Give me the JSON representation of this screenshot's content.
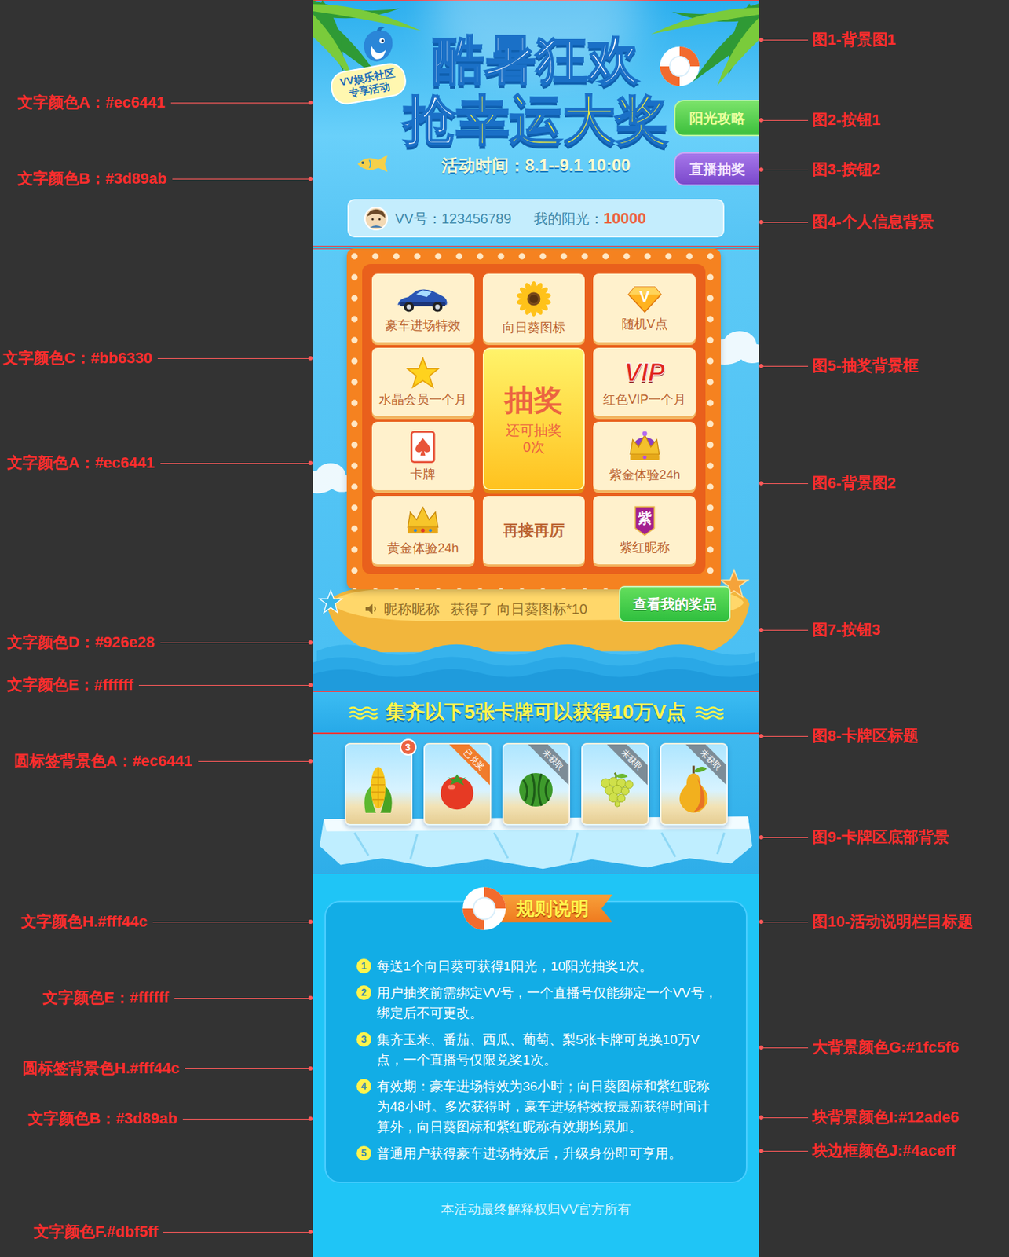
{
  "header": {
    "badge": [
      "VV娱乐社区",
      "专享活动"
    ],
    "title_line1": "酷暑狂欢",
    "title_line2": [
      "抢",
      "幸运大奖"
    ],
    "time": "活动时间：8.1--9.1 10:00",
    "buttons": [
      {
        "label": "阳光攻略",
        "kind": "guide"
      },
      {
        "label": "直播抽奖",
        "kind": "live"
      }
    ]
  },
  "user": {
    "vv_label": "VV号：",
    "vv_number": "123456789",
    "sun_label": "我的阳光：",
    "sun_value": "10000"
  },
  "lottery": {
    "tiles": [
      {
        "kind": "prize",
        "name": "豪车进场特效"
      },
      {
        "kind": "prize",
        "name": "向日葵图标"
      },
      {
        "kind": "prize",
        "name": "随机V点",
        "icon_text": "V"
      },
      {
        "kind": "prize",
        "name": "水晶会员一个月"
      },
      {
        "kind": "prize",
        "name": "红色VIP一个月",
        "icon_text": "VIP"
      },
      {
        "kind": "prize",
        "name": "卡牌"
      },
      {
        "kind": "prize",
        "name": "紫金体验24h"
      },
      {
        "kind": "prize",
        "name": "黄金体验24h"
      },
      {
        "kind": "text",
        "name": "再接再厉"
      },
      {
        "kind": "prize",
        "name": "紫红昵称",
        "icon_text": "紫"
      }
    ],
    "draw": {
      "title": "抽奖",
      "label": "还可抽奖",
      "count": "0次"
    },
    "broadcast": {
      "user": "昵称昵称",
      "message": "获得了 向日葵图标*10"
    },
    "my_prizes_button": "查看我的奖品"
  },
  "cards": {
    "title": "集齐以下5张卡牌可以获得10万V点",
    "items": [
      {
        "status": "count",
        "badge": "3"
      },
      {
        "status": "redeemed",
        "badge": "已兑奖"
      },
      {
        "status": "locked",
        "badge": "未获取"
      },
      {
        "status": "locked",
        "badge": "未获取"
      },
      {
        "status": "locked",
        "badge": "未获取"
      }
    ]
  },
  "rules": {
    "title": "规则说明",
    "items": [
      {
        "num": "1",
        "text": "每送1个向日葵可获得1阳光，10阳光抽奖1次。"
      },
      {
        "num": "2",
        "text": "用户抽奖前需绑定VV号，一个直播号仅能绑定一个VV号，绑定后不可更改。"
      },
      {
        "num": "3",
        "text": "集齐玉米、番茄、西瓜、葡萄、梨5张卡牌可兑换10万V点，一个直播号仅限兑奖1次。"
      },
      {
        "num": "4",
        "text": "有效期：豪车进场特效为36小时；向日葵图标和紫红昵称为48小时。多次获得时，豪车进场特效按最新获得时间计算外，向日葵图标和紫红昵称有效期均累加。"
      },
      {
        "num": "5",
        "text": "普通用户获得豪车进场特效后，升级身份即可享用。"
      }
    ]
  },
  "footer": "本活动最终解释权归VV官方所有",
  "annotations": [
    {
      "side": "left",
      "text": "文字颜色A：#ec6441"
    },
    {
      "side": "left",
      "text": "文字颜色B：#3d89ab"
    },
    {
      "side": "left",
      "text": "文字颜色C：#bb6330"
    },
    {
      "side": "left",
      "text": "文字颜色A：#ec6441"
    },
    {
      "side": "left",
      "text": "文字颜色D：#926e28"
    },
    {
      "side": "left",
      "text": "文字颜色E：#ffffff"
    },
    {
      "side": "left",
      "text": "圆标签背景色A：#ec6441"
    },
    {
      "side": "left",
      "text": "文字颜色H.#fff44c"
    },
    {
      "side": "left",
      "text": "文字颜色E：#ffffff"
    },
    {
      "side": "left",
      "text": "圆标签背景色H.#fff44c"
    },
    {
      "side": "left",
      "text": "文字颜色B：#3d89ab"
    },
    {
      "side": "left",
      "text": "文字颜色F.#dbf5ff"
    },
    {
      "side": "right",
      "text": "图1-背景图1"
    },
    {
      "side": "right",
      "text": "图2-按钮1"
    },
    {
      "side": "right",
      "text": "图3-按钮2"
    },
    {
      "side": "right",
      "text": "图4-个人信息背景"
    },
    {
      "side": "right",
      "text": "图5-抽奖背景框"
    },
    {
      "side": "right",
      "text": "图6-背景图2"
    },
    {
      "side": "right",
      "text": "图7-按钮3"
    },
    {
      "side": "right",
      "text": "图8-卡牌区标题"
    },
    {
      "side": "right",
      "text": "图9-卡牌区底部背景"
    },
    {
      "side": "right",
      "text": "图10-活动说明栏目标题"
    },
    {
      "side": "right",
      "text": "大背景颜色G:#1fc5f6"
    },
    {
      "side": "right",
      "text": "块背景颜色I:#12ade6"
    },
    {
      "side": "right",
      "text": "块边框颜色J:#4aceff"
    }
  ]
}
